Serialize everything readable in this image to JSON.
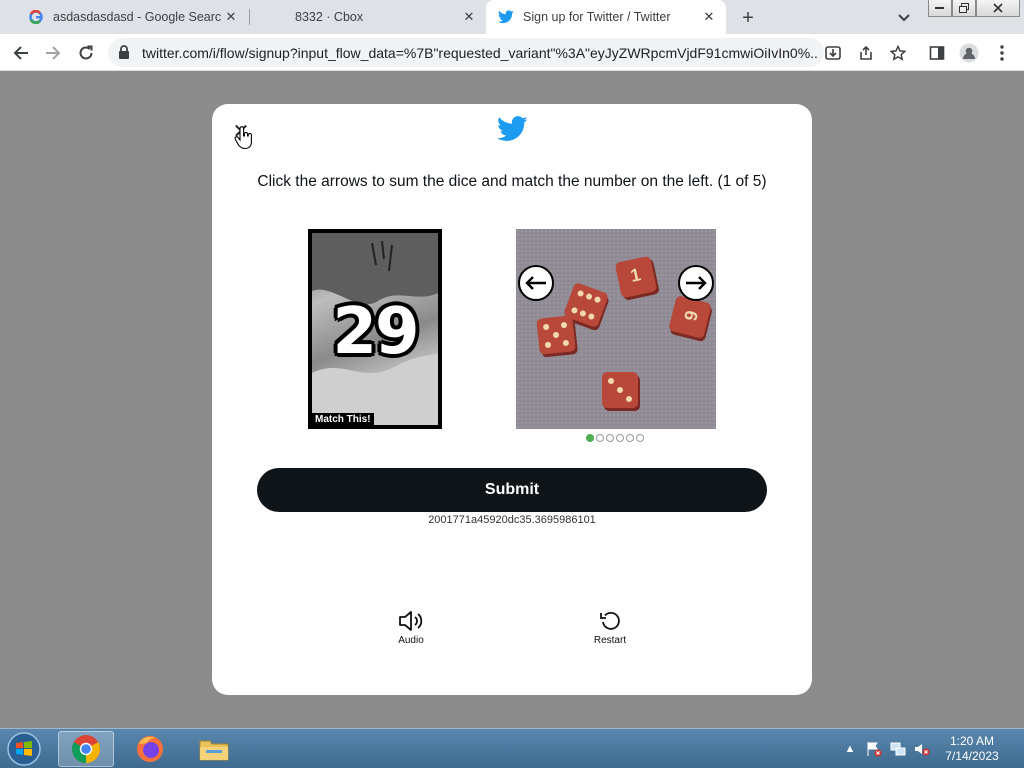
{
  "browser": {
    "tabs": [
      {
        "title": "asdasdasdasd - Google Search",
        "favicon": "google-icon",
        "active": false
      },
      {
        "title": "8332 · Cbox",
        "favicon": "none",
        "active": false
      },
      {
        "title": "Sign up for Twitter / Twitter",
        "favicon": "twitter-bird-icon",
        "active": true
      }
    ],
    "new_tab": "+",
    "url": "twitter.com/i/flow/signup?input_flow_data=%7B\"requested_variant\"%3A\"eyJyZWRpcmVjdF91cmwiOiIvIn0%..."
  },
  "captcha": {
    "instruction": "Click the arrows to sum the dice and match the number on the left. (1 of 5)",
    "match_number": "29",
    "match_label": "Match This!",
    "dice_face_numbers": [
      "1",
      "6"
    ],
    "pagination": {
      "total": 6,
      "current": 1
    },
    "submit_label": "Submit",
    "session_id": "2001771a45920dc35.3695986101",
    "audio_label": "Audio",
    "restart_label": "Restart"
  },
  "taskbar": {
    "clock_time": "1:20 AM",
    "clock_date": "7/14/2023",
    "apps": [
      "chrome-icon",
      "firefox-icon",
      "file-explorer-icon"
    ]
  },
  "colors": {
    "twitter_blue": "#1d9bf0",
    "submit_bg": "#0f1419",
    "overlay": "#8c8c8c",
    "dot_active": "#4caf50"
  }
}
